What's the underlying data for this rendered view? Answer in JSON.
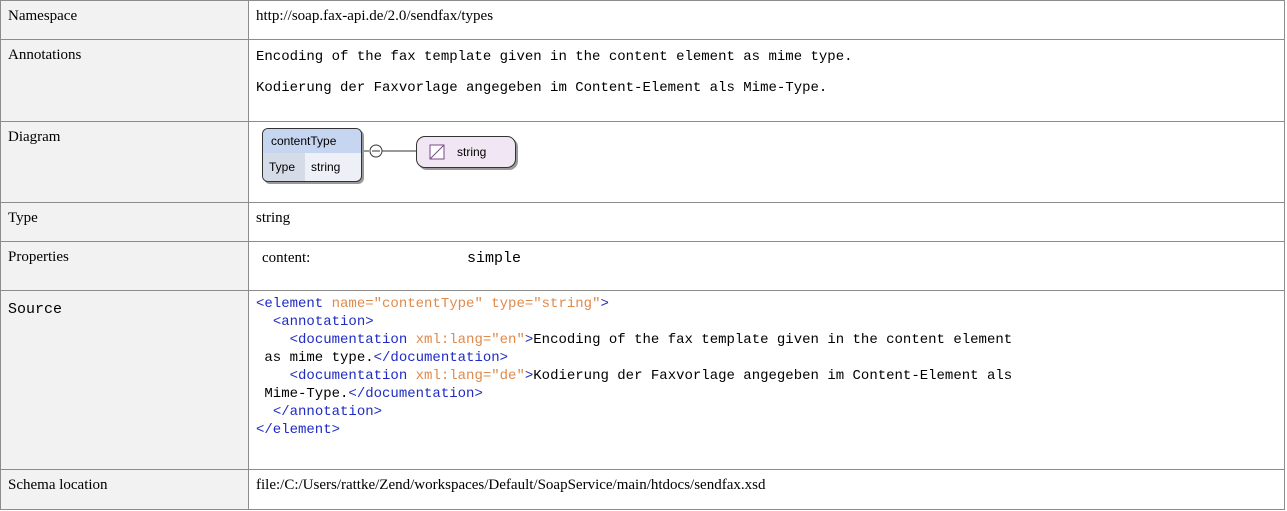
{
  "rows": {
    "namespace": {
      "label": "Namespace",
      "value": "http://soap.fax-api.de/2.0/sendfax/types"
    },
    "annotations": {
      "label": "Annotations",
      "en": "Encoding of the fax template given in the content element as mime type.",
      "de": "Kodierung der Faxvorlage angegeben im Content-Element als Mime-Type."
    },
    "diagram": {
      "label": "Diagram",
      "element_name": "contentType",
      "type_label": "Type",
      "type_value": "string",
      "simple_type": "string"
    },
    "type": {
      "label": "Type",
      "value": "string"
    },
    "properties": {
      "label": "Properties",
      "key": "content:",
      "value": "simple"
    },
    "source": {
      "label": "Source",
      "line1_open": "<element",
      "line1_attr": " name=\"contentType\" type=\"string\"",
      "line1_close": ">",
      "line2": "<annotation>",
      "doc_open": "<documentation",
      "lang_en": " xml:lang=\"en\"",
      "gt": ">",
      "en_text_1": "Encoding of the fax template given in the content element",
      "en_text_2": " as mime type.",
      "doc_close": "</documentation>",
      "lang_de": " xml:lang=\"de\"",
      "de_text_1": "Kodierung der Faxvorlage angegeben im Content-Element als",
      "de_text_2": " Mime-Type.",
      "annotation_close": "</annotation>",
      "element_close": "</element>"
    },
    "schema_location": {
      "label": "Schema location",
      "value": "file:/C:/Users/rattke/Zend/workspaces/Default/SoapService/main/htdocs/sendfax.xsd"
    }
  }
}
